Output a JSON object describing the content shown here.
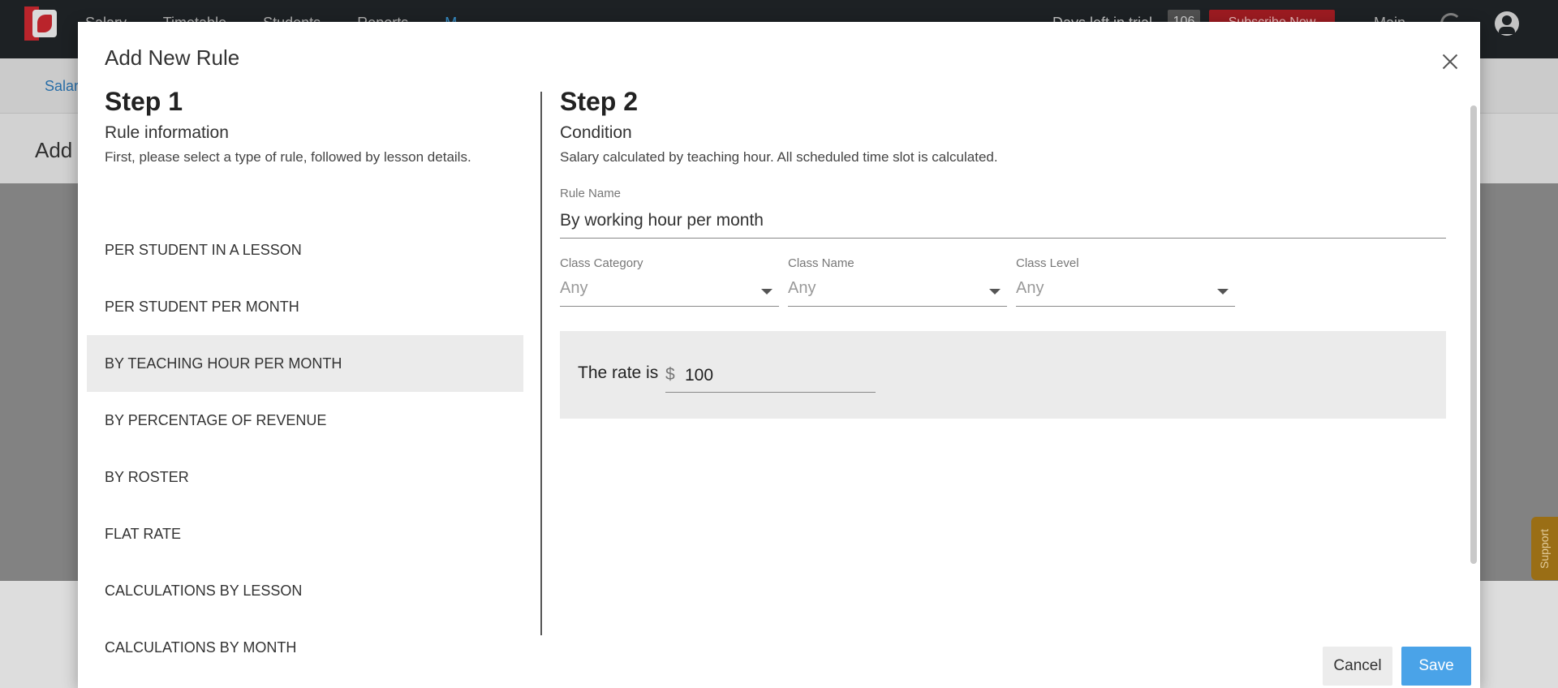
{
  "app": {
    "nav_items": [
      "Salary",
      "Timetable",
      "Students",
      "Reports",
      "M"
    ],
    "trial_text": "Days left in trial",
    "trial_days": "106",
    "subscribe_label": "Subscribe Now",
    "main_label": "Main",
    "breadcrumb": "Salar",
    "page_title": "Add",
    "support_label": "Support"
  },
  "modal": {
    "title": "Add New Rule",
    "step1": {
      "heading": "Step 1",
      "subheading": "Rule information",
      "description": "First, please select a type of rule, followed by lesson details.",
      "rules": [
        "PER STUDENT IN A LESSON",
        "PER STUDENT PER MONTH",
        "BY TEACHING HOUR PER MONTH",
        "BY PERCENTAGE OF REVENUE",
        "BY ROSTER",
        "FLAT RATE",
        "CALCULATIONS BY LESSON",
        "CALCULATIONS BY MONTH"
      ],
      "selected_index": 2
    },
    "step2": {
      "heading": "Step 2",
      "subheading": "Condition",
      "description": "Salary calculated by teaching hour. All scheduled time slot is calculated.",
      "rule_name_label": "Rule Name",
      "rule_name_value": "By working hour per month",
      "class_category_label": "Class Category",
      "class_category_value": "Any",
      "class_name_label": "Class Name",
      "class_name_value": "Any",
      "class_level_label": "Class Level",
      "class_level_value": "Any",
      "rate_label": "The rate is",
      "currency_symbol": "$",
      "rate_value": "100"
    },
    "cancel_label": "Cancel",
    "save_label": "Save"
  },
  "colors": {
    "topbar": "#1f2326",
    "accent_blue": "#4aa3e8",
    "subscribe_red": "#a51d23",
    "selected_row": "#ebebeb"
  }
}
